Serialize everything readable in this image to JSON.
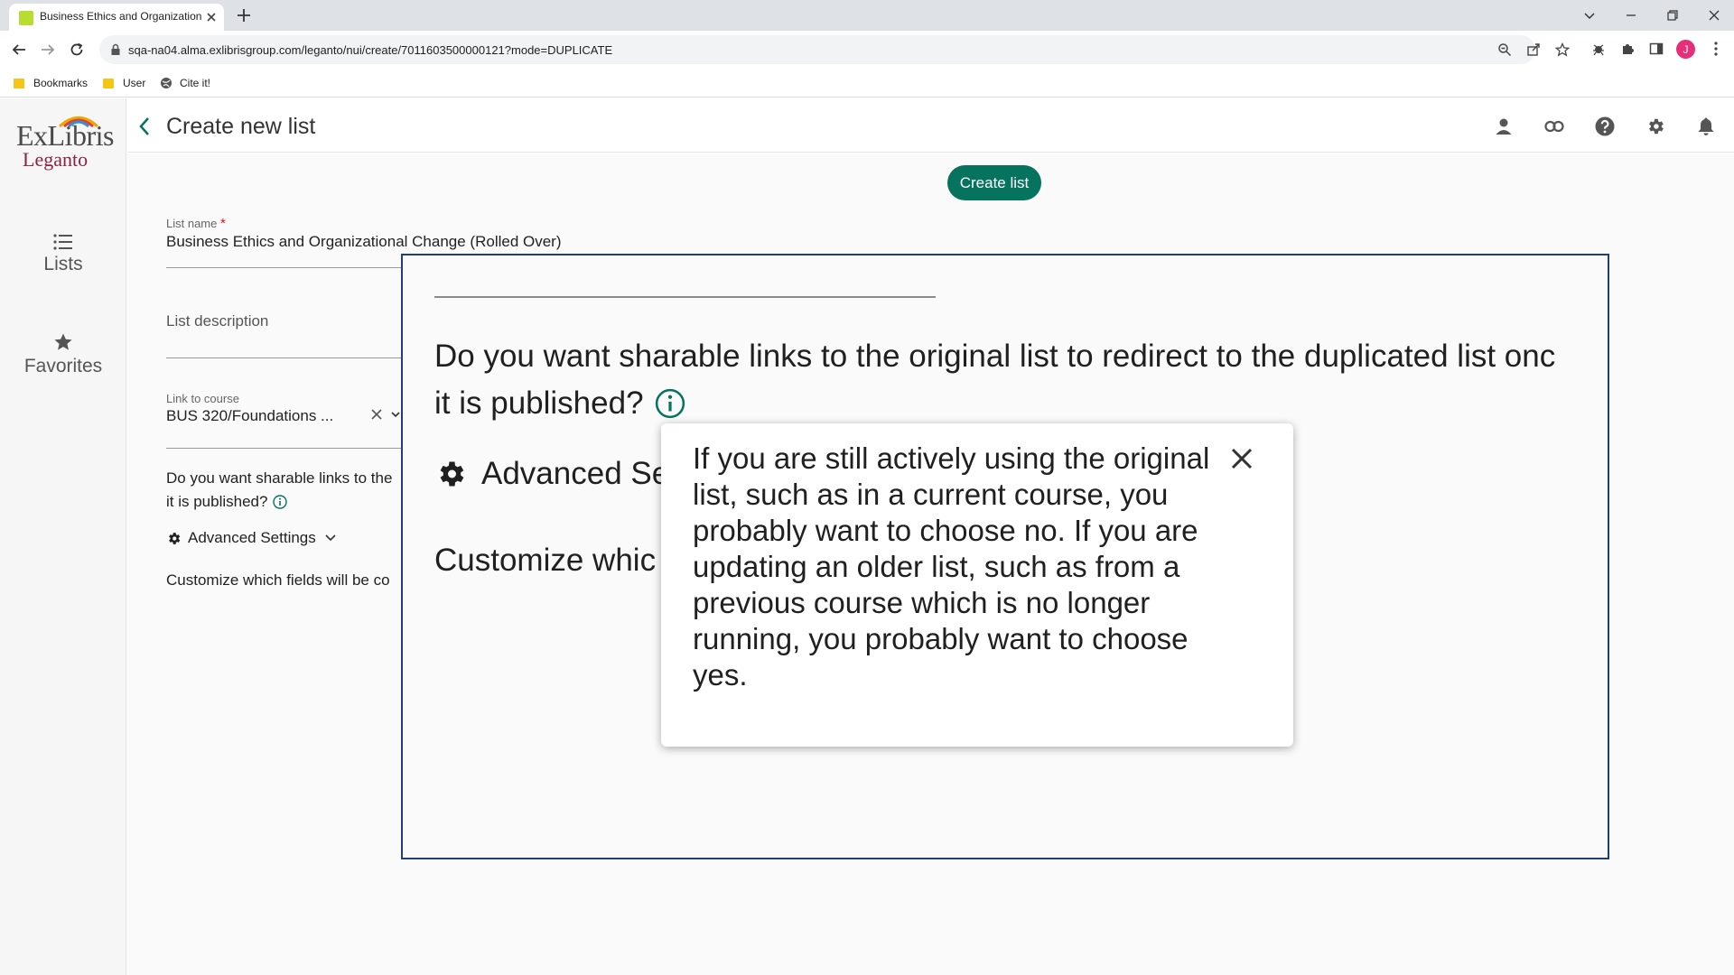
{
  "browser": {
    "tab_title": "Business Ethics and Organization",
    "url": "sqa-na04.alma.exlibrisgroup.com/leganto/nui/create/7011603500000121?mode=DUPLICATE",
    "profile_initial": "J",
    "bookmarks": [
      {
        "label": "Bookmarks",
        "icon": "folder-icon"
      },
      {
        "label": "User",
        "icon": "folder-icon"
      },
      {
        "label": "Cite it!",
        "icon": "globe-icon"
      }
    ]
  },
  "sidebar": {
    "logo_top": "ExLibris",
    "logo_bottom": "Leganto",
    "items": [
      {
        "label": "Lists",
        "icon": "list-icon"
      },
      {
        "label": "Favorites",
        "icon": "star-icon"
      }
    ]
  },
  "header": {
    "title": "Create new list"
  },
  "form": {
    "create_button": "Create list",
    "list_name_label": "List name",
    "required_marker": "*",
    "list_name_value": "Business Ethics and Organizational Change (Rolled Over)",
    "description_placeholder": "List description",
    "course_label": "Link to course",
    "course_value": "BUS 320/Foundations ...",
    "redirect_question_line1": "Do you want sharable links to the",
    "redirect_question_line2": "it is published?",
    "advanced_settings": "Advanced Settings",
    "customize_text": "Customize which fields will be co"
  },
  "magnified": {
    "question_line1": "Do you want sharable links to the original list to redirect to the duplicated list onc",
    "question_line2": "it is published?",
    "advanced_text": "Advanced Se",
    "customize_text": "Customize whic"
  },
  "tooltip": {
    "text": "If you are still actively using the original list, such as in a current course, you probably want to choose no. If you are updating an older list, such as from a previous course which is no longer running, you probably want to choose yes."
  },
  "colors": {
    "accent": "#06735f",
    "brand_red": "#8b2246",
    "magnifier_border": "#1f3f77",
    "profile": "#e52f7a"
  }
}
